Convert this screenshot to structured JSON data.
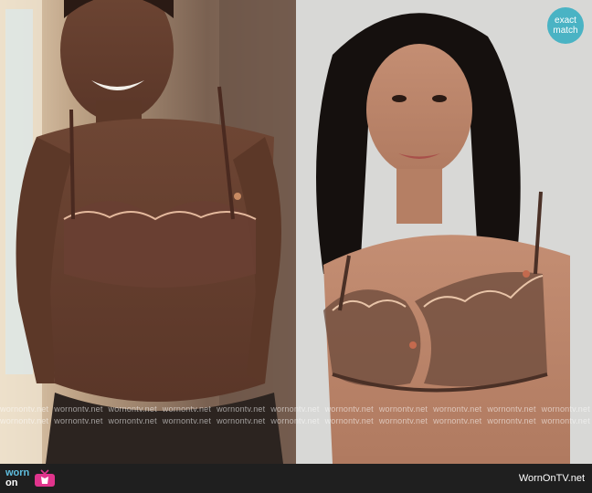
{
  "badge": {
    "line1": "exact",
    "line2": "match"
  },
  "watermark": {
    "text": "wornontv.net",
    "repeats": 11
  },
  "footer": {
    "logo_line1": "worn",
    "logo_line2": "on",
    "logo_icon": "tv-icon",
    "site": "WornOnTV.net"
  },
  "colors": {
    "badge": "#4ab3c4",
    "footer_bg": "#1f1f1f",
    "logo_accent": "#5fbfe0",
    "tv_icon": "#e0348c"
  }
}
